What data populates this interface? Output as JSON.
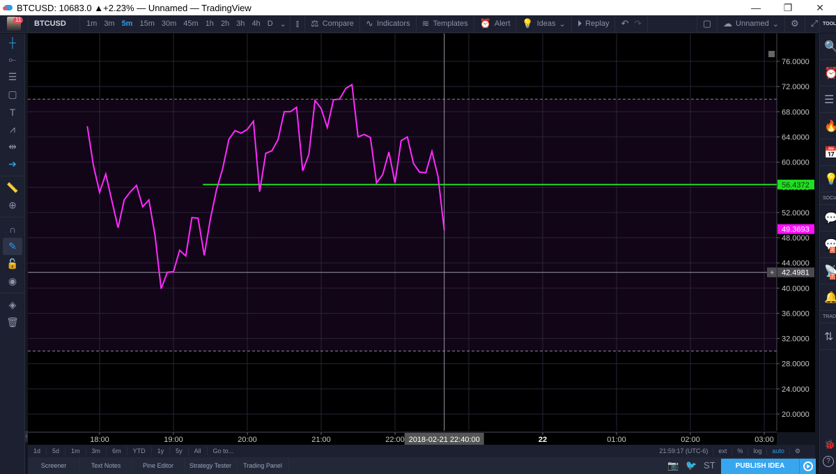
{
  "window": {
    "title": "BTCUSD: 10683.0 ▲+2.23% — Unnamed — TradingView",
    "controls": [
      "—",
      "❐",
      "✕"
    ]
  },
  "topbar": {
    "avatar_badge": "11",
    "symbol": "BTCUSD",
    "intervals": [
      "1m",
      "3m",
      "5m",
      "15m",
      "30m",
      "45m",
      "1h",
      "2h",
      "3h",
      "4h",
      "D"
    ],
    "active_interval": "5m",
    "compare_label": "Compare",
    "indicators_label": "Indicators",
    "templates_label": "Templates",
    "alert_label": "Alert",
    "ideas_label": "Ideas",
    "replay_label": "Replay",
    "layout_name": "Unnamed",
    "tools_header": "TOOLS"
  },
  "left_tools": [
    {
      "name": "crosshair-icon",
      "glyph": "┼"
    },
    {
      "name": "trend-line-icon",
      "glyph": "⟜"
    },
    {
      "name": "fib-icon",
      "glyph": "☰"
    },
    {
      "name": "rectangle-icon",
      "glyph": "▢"
    },
    {
      "name": "text-icon",
      "glyph": "T"
    },
    {
      "name": "pattern-icon",
      "glyph": "⩘"
    },
    {
      "name": "prediction-icon",
      "glyph": "⇹"
    },
    {
      "name": "arrow-icon",
      "glyph": "➔"
    },
    {
      "name": "ruler-icon",
      "glyph": "📏"
    },
    {
      "name": "zoom-in-icon",
      "glyph": "⊕"
    },
    {
      "name": "magnet-icon",
      "glyph": "∩"
    },
    {
      "name": "lock-drawing-icon",
      "glyph": "✎"
    },
    {
      "name": "unlock-icon",
      "glyph": "🔓"
    },
    {
      "name": "eye-icon",
      "glyph": "◉"
    },
    {
      "name": "layers-icon",
      "glyph": "◈"
    },
    {
      "name": "trash-icon",
      "glyph": "🗑"
    }
  ],
  "chart_data": {
    "type": "line",
    "symbol": "BTCUSD",
    "interval": "5m",
    "line_color": "#ff2bff",
    "x_start": "17:50",
    "x_step_minutes": 5,
    "values": [
      65.7,
      59.4,
      55.2,
      58.1,
      53.8,
      49.6,
      54.0,
      55.3,
      56.3,
      52.9,
      54.0,
      48.4,
      39.9,
      42.5,
      42.6,
      46.0,
      45.1,
      51.2,
      51.1,
      45.2,
      51.0,
      55.6,
      59.0,
      63.6,
      65.0,
      64.6,
      65.2,
      66.5,
      55.3,
      61.4,
      61.8,
      63.6,
      68.0,
      68.0,
      68.7,
      58.6,
      61.2,
      69.8,
      68.5,
      65.5,
      69.9,
      70.0,
      71.7,
      72.3,
      64.0,
      64.4,
      63.9,
      56.7,
      58.0,
      61.6,
      56.7,
      63.4,
      64.0,
      59.8,
      58.4,
      58.3,
      61.7,
      57.7,
      49.2
    ],
    "ylim": [
      18,
      78
    ],
    "y_ticks": [
      "76.0000",
      "72.0000",
      "68.0000",
      "64.0000",
      "60.0000",
      "56.0000",
      "52.0000",
      "48.0000",
      "44.0000",
      "40.0000",
      "36.0000",
      "32.0000",
      "28.0000",
      "24.0000",
      "20.0000"
    ],
    "x_ticks": [
      "18:00",
      "19:00",
      "20:00",
      "21:00",
      "22:00",
      "22",
      "01:00",
      "02:00",
      "03:00"
    ],
    "upper_band": 70,
    "lower_band": 30,
    "band_fill": "#120518",
    "horizontal_line": {
      "value": 56.4372,
      "label": "56.4372",
      "color": "#22dd22",
      "start": "19:25"
    },
    "last_value_label": {
      "value": 49.3693,
      "label": "49.3693",
      "color": "#ff10ff"
    },
    "crosshair": {
      "value": 42.4981,
      "label": "42.4981",
      "time_label": "2018-02-21 22:40:00"
    }
  },
  "rangebar": {
    "ranges": [
      "1d",
      "5d",
      "1m",
      "3m",
      "6m",
      "YTD",
      "1y",
      "5y",
      "All",
      "Go to..."
    ],
    "clock": "21:59:17 (UTC-6)",
    "options": [
      "ext",
      "%",
      "log",
      "auto"
    ],
    "active_option": "auto"
  },
  "bottom_panel": {
    "tabs": [
      "Screener",
      "Text Notes",
      "Pine Editor",
      "Strategy Tester",
      "Trading Panel"
    ],
    "st_label": "ST",
    "publish_label": "PUBLISH IDEA"
  },
  "right_tools": {
    "social_label": "SOCIAL",
    "trade_label": "TRADE",
    "chat_badge": "2",
    "streams_badge": "7"
  }
}
